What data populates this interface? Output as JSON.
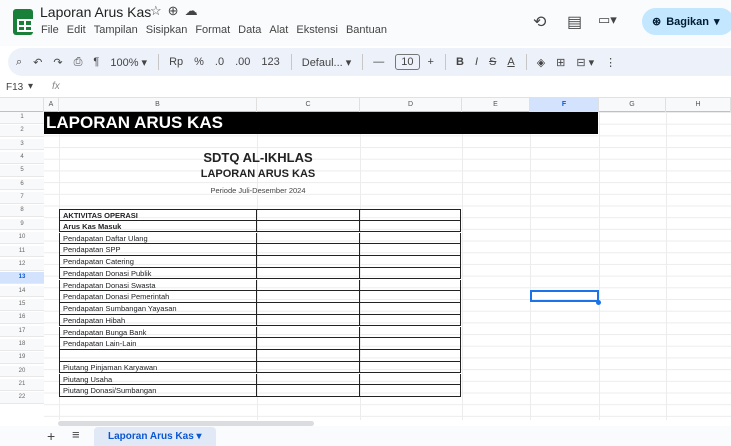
{
  "app": {
    "doc_title": "Laporan Arus Kas",
    "menu": [
      "File",
      "Edit",
      "Tampilan",
      "Sisipkan",
      "Format",
      "Data",
      "Alat",
      "Ekstensi",
      "Bantuan"
    ],
    "share_label": "Bagikan",
    "accent_color": "#188038"
  },
  "toolbar": {
    "zoom": "100%",
    "currency": "Rp",
    "percent": "%",
    "decrease_decimal": ".0",
    "increase_decimal": ".00",
    "number_format": "123",
    "font": "Defaul...",
    "font_size": "10",
    "bold": "B",
    "italic": "I",
    "strike": "S",
    "text_color": "A"
  },
  "formula_bar": {
    "cell_ref": "F13",
    "fx": "fx"
  },
  "grid": {
    "columns": [
      "A",
      "B",
      "C",
      "D",
      "E",
      "F",
      "G",
      "H"
    ],
    "active_column": "F",
    "rows": [
      "1",
      "2",
      "3",
      "4",
      "5",
      "6",
      "7",
      "8",
      "9",
      "10",
      "11",
      "12",
      "13",
      "14",
      "15",
      "16",
      "17",
      "18",
      "19",
      "20",
      "21",
      "22"
    ],
    "active_row": "13"
  },
  "sheet": {
    "banner": "LAPORAN ARUS KAS",
    "school_name": "SDTQ AL-IKHLAS",
    "report_title": "LAPORAN ARUS KAS",
    "period": "Periode Juli-Desember 2024",
    "table_rows": [
      {
        "label": "AKTIVITAS OPERASI",
        "bold": true
      },
      {
        "label": "Arus Kas Masuk",
        "bold": true
      },
      {
        "label": "Pendapatan Daftar Ulang",
        "bold": false
      },
      {
        "label": "Pendapatan SPP",
        "bold": false
      },
      {
        "label": "Pendapatan Catering",
        "bold": false
      },
      {
        "label": "Pendapatan Donasi Publik",
        "bold": false
      },
      {
        "label": "Pendapatan Donasi Swasta",
        "bold": false
      },
      {
        "label": "Pendapatan Donasi Pemerintah",
        "bold": false
      },
      {
        "label": "Pendapatan Sumbangan Yayasan",
        "bold": false
      },
      {
        "label": "Pendapatan Hibah",
        "bold": false
      },
      {
        "label": "Pendapatan Bunga Bank",
        "bold": false
      },
      {
        "label": "Pendapatan Lain-Lain",
        "bold": false
      },
      {
        "label": "",
        "bold": false
      },
      {
        "label": "Piutang Pinjaman Karyawan",
        "bold": false
      },
      {
        "label": "Piutang Usaha",
        "bold": false
      },
      {
        "label": "Piutang Donasi/Sumbangan",
        "bold": false
      }
    ]
  },
  "tabs": {
    "active_sheet": "Laporan Arus Kas"
  }
}
